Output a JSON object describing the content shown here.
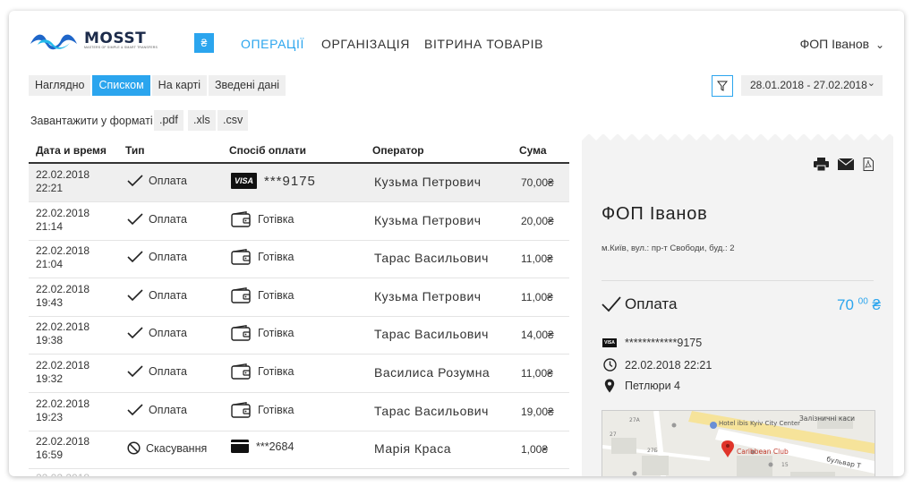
{
  "brand": {
    "name": "MOSST",
    "tagline": "MASTERS OF SIMPLE & SMART TRANSFERS"
  },
  "nav": {
    "badge": "₴",
    "items": [
      "ОПЕРАЦІЇ",
      "ОРГАНІЗАЦІЯ",
      "ВІТРИНА ТОВАРІВ"
    ],
    "active": 0
  },
  "user": {
    "name": "ФОП Іванов",
    "chevron": "⌄"
  },
  "view_tabs": [
    "Наглядно",
    "Списком",
    "На карті",
    "Зведені дані"
  ],
  "active_tab": 1,
  "date_range": "28.01.2018 - 27.02.2018",
  "download": {
    "label": "Завантажити у форматі",
    "formats": [
      ".pdf",
      ".xls",
      ".csv"
    ]
  },
  "table": {
    "headers": [
      "Дата и время",
      "Тип",
      "Спосіб оплати",
      "Оператор",
      "Сума"
    ],
    "rows": [
      {
        "date": "22.02.2018",
        "time": "22:21",
        "type": "Оплата",
        "type_icon": "check-icon",
        "pay_icon": "visa",
        "pay": "***9175",
        "operator": "Кузьма Петрович",
        "sum": "70,00₴",
        "selected": true
      },
      {
        "date": "22.02.2018",
        "time": "21:14",
        "type": "Оплата",
        "type_icon": "check-icon",
        "pay_icon": "wallet",
        "pay": "Готівка",
        "operator": "Кузьма Петрович",
        "sum": "20,00₴"
      },
      {
        "date": "22.02.2018",
        "time": "21:04",
        "type": "Оплата",
        "type_icon": "check-icon",
        "pay_icon": "wallet",
        "pay": "Готівка",
        "operator": "Тарас Васильович",
        "sum": "11,00₴"
      },
      {
        "date": "22.02.2018",
        "time": "19:43",
        "type": "Оплата",
        "type_icon": "check-icon",
        "pay_icon": "wallet",
        "pay": "Готівка",
        "operator": "Кузьма Петрович",
        "sum": "11,00₴"
      },
      {
        "date": "22.02.2018",
        "time": "19:38",
        "type": "Оплата",
        "type_icon": "check-icon",
        "pay_icon": "wallet",
        "pay": "Готівка",
        "operator": "Тарас Васильович",
        "sum": "14,00₴"
      },
      {
        "date": "22.02.2018",
        "time": "19:32",
        "type": "Оплата",
        "type_icon": "check-icon",
        "pay_icon": "wallet",
        "pay": "Готівка",
        "operator": "Василиса Розумна",
        "sum": "11,00₴"
      },
      {
        "date": "22.02.2018",
        "time": "19:23",
        "type": "Оплата",
        "type_icon": "check-icon",
        "pay_icon": "wallet",
        "pay": "Готівка",
        "operator": "Тарас Васильович",
        "sum": "19,00₴"
      },
      {
        "date": "22.02.2018",
        "time": "16:59",
        "type": "Скасування",
        "type_icon": "cancel-icon",
        "pay_icon": "card",
        "pay": "***2684",
        "operator": "Марія Краса",
        "sum": "1,00₴"
      }
    ]
  },
  "details": {
    "title": "ФОП Іванов",
    "address": "м.Київ, вул.: пр-т Свободи, буд.: 2",
    "status": "Оплата",
    "amount_main": "70",
    "amount_cents": "00",
    "currency": "₴",
    "card": "************9175",
    "datetime": "22.02.2018 22:21",
    "operator": "Петлюри 4",
    "map": {
      "street_1": "Залізничні каси",
      "street_2": "бульвар Т",
      "place_1": "Hotel ibis Kyiv City Center",
      "place_2": "Caribbean Club",
      "num_1": "27А",
      "num_2": "27",
      "num_3": "27Б",
      "num_4": "15"
    }
  },
  "colors": {
    "accent": "#2ba5ee",
    "tab_bg": "#efefef",
    "panel_bg": "#f3f3f3"
  }
}
